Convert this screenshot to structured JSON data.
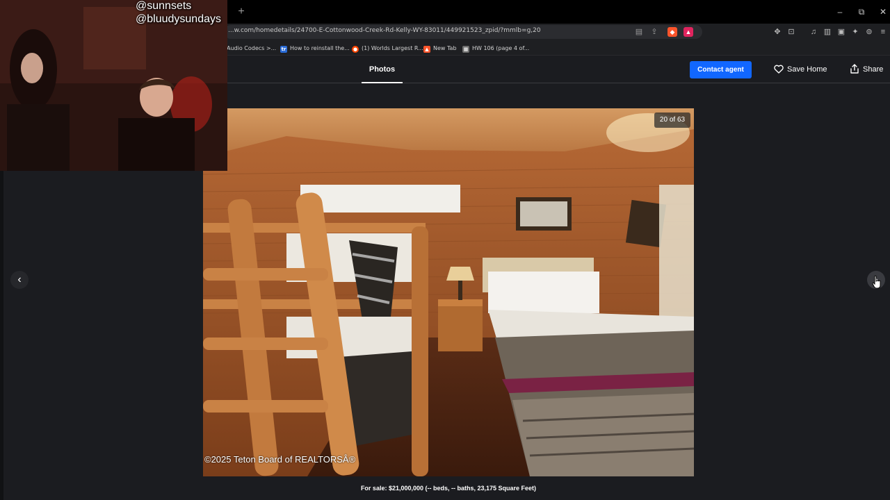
{
  "browser": {
    "new_tab_glyph": "+",
    "window_buttons": [
      "–",
      "⧉",
      "✕"
    ],
    "url": "...w.com/homedetails/24700-E-Cottonwood-Creek-Rd-Kelly-WY-83011/449921523_zpid/?mmlb=g,20",
    "bookmarks": [
      {
        "label": "Audio Codecs >...",
        "icon": "blank-icon",
        "color": "#1e1f22"
      },
      {
        "label": "How to reinstall the...",
        "icon": "tr-icon",
        "icon_text": "tr",
        "color": "#2a6bd6"
      },
      {
        "label": "(1) Worlds Largest R...",
        "icon": "reddit-icon",
        "icon_text": "●",
        "color": "#ff4500"
      },
      {
        "label": "New Tab",
        "icon": "brave-icon",
        "icon_text": "▲",
        "color": "#fb542b"
      },
      {
        "label": "HW 106 (page 4 of...",
        "icon": "doc-icon",
        "icon_text": "▦",
        "color": "#6d6d6d"
      }
    ]
  },
  "header": {
    "tab_label": "Photos",
    "contact_label": "Contact agent",
    "save_label": "Save Home",
    "share_label": "Share"
  },
  "viewer": {
    "counter": "20 of 63",
    "watermark": "©2025 Teton Board of REALTORSÂ®",
    "caption": "For sale: $21,000,000 (-- beds, -- baths, 23,175 Square Feet)",
    "prev_glyph": "‹",
    "next_glyph": "›"
  },
  "webcam": {
    "handle_1": "@sunnsets",
    "handle_2": "@bluudysundays"
  },
  "colors": {
    "accent": "#1167ff",
    "background": "#1b1c20"
  }
}
